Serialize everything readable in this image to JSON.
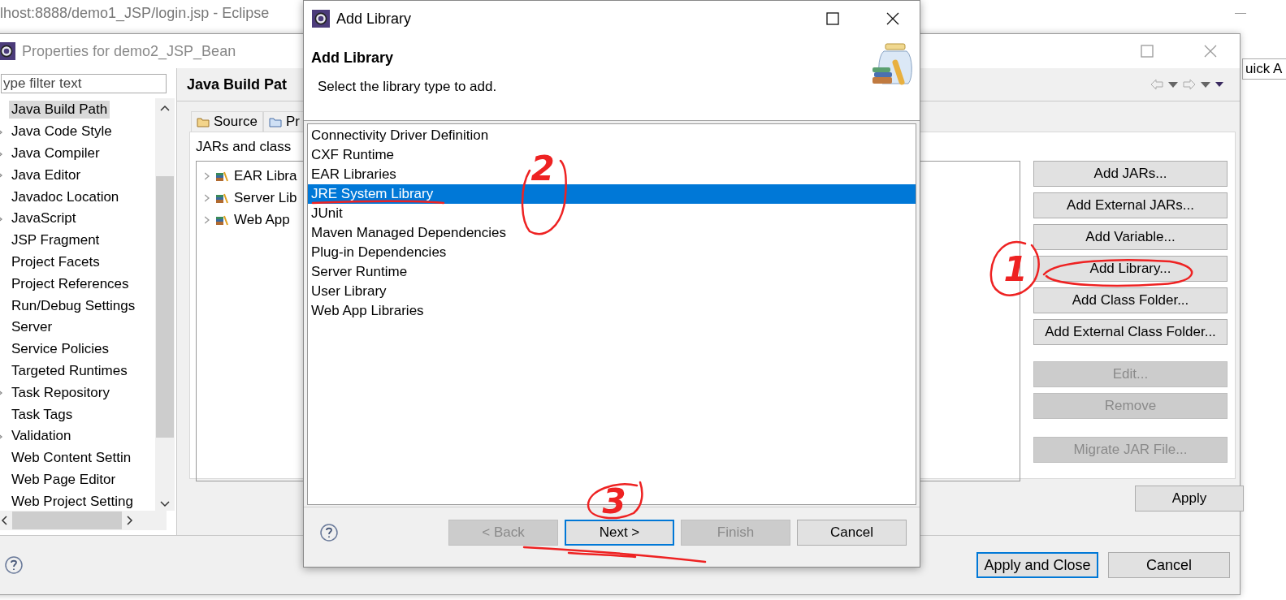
{
  "eclipse_window": {
    "title": "lhost:8888/demo1_JSP/login.jsp - Eclipse",
    "quick_access": {
      "value": "uick A"
    }
  },
  "properties_dialog": {
    "title": "Properties for demo2_JSP_Bean",
    "filter": {
      "placeholder": "ype filter text"
    },
    "nav_items": [
      {
        "label": "Java Build Path",
        "selected": true,
        "has_children": false
      },
      {
        "label": "Java Code Style",
        "selected": false,
        "has_children": true
      },
      {
        "label": "Java Compiler",
        "selected": false,
        "has_children": true
      },
      {
        "label": "Java Editor",
        "selected": false,
        "has_children": true
      },
      {
        "label": "Javadoc Location",
        "selected": false,
        "has_children": false
      },
      {
        "label": "JavaScript",
        "selected": false,
        "has_children": true
      },
      {
        "label": "JSP Fragment",
        "selected": false,
        "has_children": false
      },
      {
        "label": "Project Facets",
        "selected": false,
        "has_children": false
      },
      {
        "label": "Project References",
        "selected": false,
        "has_children": false
      },
      {
        "label": "Run/Debug Settings",
        "selected": false,
        "has_children": false
      },
      {
        "label": "Server",
        "selected": false,
        "has_children": false
      },
      {
        "label": "Service Policies",
        "selected": false,
        "has_children": false
      },
      {
        "label": "Targeted Runtimes",
        "selected": false,
        "has_children": false
      },
      {
        "label": "Task Repository",
        "selected": false,
        "has_children": true
      },
      {
        "label": "Task Tags",
        "selected": false,
        "has_children": false
      },
      {
        "label": "Validation",
        "selected": false,
        "has_children": true
      },
      {
        "label": "Web Content Settin",
        "selected": false,
        "has_children": false
      },
      {
        "label": "Web Page Editor",
        "selected": false,
        "has_children": false
      },
      {
        "label": "Web Project Setting",
        "selected": false,
        "has_children": false
      }
    ],
    "page_title": "Java Build Pat",
    "tabs": [
      {
        "label": "Source",
        "selected": false
      },
      {
        "label": "Pr",
        "selected": false
      }
    ],
    "section_label": "JARs and class",
    "tree_items": [
      {
        "label": "EAR Libra"
      },
      {
        "label": "Server Lib"
      },
      {
        "label": "Web App"
      }
    ],
    "side_buttons": [
      {
        "label": "Add JARs...",
        "disabled": false
      },
      {
        "label": "Add External JARs...",
        "disabled": false
      },
      {
        "label": "Add Variable...",
        "disabled": false
      },
      {
        "label": "Add Library...",
        "disabled": false
      },
      {
        "label": "Add Class Folder...",
        "disabled": false
      },
      {
        "label": "Add External Class Folder...",
        "disabled": false
      },
      {
        "label": "Edit...",
        "disabled": true
      },
      {
        "label": "Remove",
        "disabled": true
      },
      {
        "label": "Migrate JAR File...",
        "disabled": true
      }
    ],
    "apply_button": "Apply",
    "footer_buttons": [
      {
        "label": "Apply and Close",
        "default": true
      },
      {
        "label": "Cancel",
        "default": false
      }
    ]
  },
  "add_library_dialog": {
    "title": "Add Library",
    "heading": "Add Library",
    "description": "Select the library type to add.",
    "library_types": [
      {
        "label": "Connectivity Driver Definition",
        "selected": false
      },
      {
        "label": "CXF Runtime",
        "selected": false
      },
      {
        "label": "EAR Libraries",
        "selected": false
      },
      {
        "label": "JRE System Library",
        "selected": true
      },
      {
        "label": "JUnit",
        "selected": false
      },
      {
        "label": "Maven Managed Dependencies",
        "selected": false
      },
      {
        "label": "Plug-in Dependencies",
        "selected": false
      },
      {
        "label": "Server Runtime",
        "selected": false
      },
      {
        "label": "User Library",
        "selected": false
      },
      {
        "label": "Web App Libraries",
        "selected": false
      }
    ],
    "buttons": [
      {
        "label": "< Back",
        "disabled": true,
        "default": false
      },
      {
        "label": "Next >",
        "disabled": false,
        "default": true
      },
      {
        "label": "Finish",
        "disabled": true,
        "default": false
      },
      {
        "label": "Cancel",
        "disabled": false,
        "default": false
      }
    ]
  },
  "annotations": [
    {
      "label": "1"
    },
    {
      "label": "2"
    },
    {
      "label": "3"
    }
  ]
}
